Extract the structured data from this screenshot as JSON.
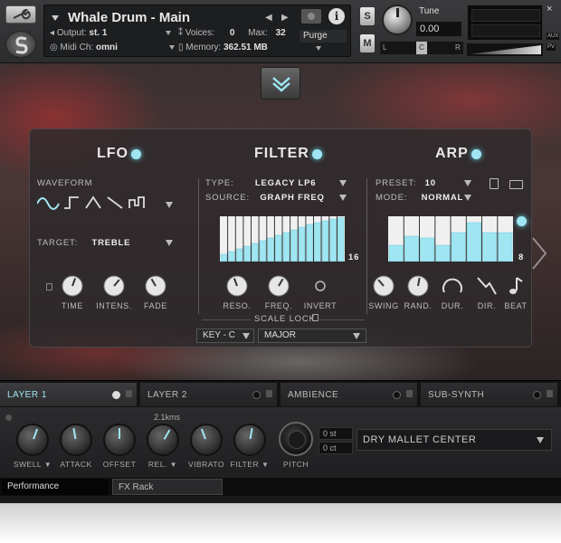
{
  "header": {
    "title": "Whale Drum - Main",
    "output_label": "Output:",
    "output_value": "st. 1",
    "midi_label": "Midi Ch:",
    "midi_value": "omni",
    "voices_label": "Voices:",
    "voices_value": "0",
    "max_label": "Max:",
    "max_value": "32",
    "memory_label": "Memory:",
    "memory_value": "362.51 MB",
    "purge_label": "Purge",
    "solo_label": "S",
    "mute_label": "M",
    "tune_label": "Tune",
    "tune_value": "0.00",
    "pan_left": "L",
    "pan_center": "C",
    "pan_right": "R",
    "aux_label": "AUX",
    "pv_label": "PV",
    "close": "×"
  },
  "lfo": {
    "title": "LFO",
    "waveform_label": "WAVEFORM",
    "target_label": "TARGET:",
    "target_value": "TREBLE",
    "knobs": [
      "TIME",
      "INTENS.",
      "FADE"
    ]
  },
  "filter": {
    "title": "FILTER",
    "type_label": "TYPE:",
    "type_value": "LEGACY LP6",
    "source_label": "SOURCE:",
    "source_value": "GRAPH FREQ",
    "steps_count": "16",
    "step_values": [
      0.16,
      0.22,
      0.28,
      0.34,
      0.4,
      0.46,
      0.52,
      0.58,
      0.64,
      0.7,
      0.76,
      0.82,
      0.86,
      0.9,
      0.94,
      0.97
    ],
    "knobs": [
      "RESO.",
      "FREQ.",
      "INVERT"
    ],
    "scale_lock_label": "SCALE LOCK",
    "key_value": "KEY - C",
    "scale_value": "MAJOR"
  },
  "arp": {
    "title": "ARP",
    "preset_label": "PRESET:",
    "preset_value": "10",
    "mode_label": "MODE:",
    "mode_value": "NORMAL",
    "steps_count": "8",
    "step_values": [
      0.36,
      0.56,
      0.52,
      0.36,
      0.64,
      0.86,
      0.64,
      0.64
    ],
    "knobs": [
      "SWING",
      "RAND.",
      "DUR.",
      "DIR.",
      "BEAT"
    ]
  },
  "layers": [
    {
      "name": "LAYER 1"
    },
    {
      "name": "LAYER 2"
    },
    {
      "name": "AMBIENCE"
    },
    {
      "name": "SUB-SYNTH"
    }
  ],
  "controls": {
    "knobs": [
      "SWELL",
      "ATTACK",
      "OFFSET",
      "REL.",
      "VIBRATO",
      "FILTER",
      "PITCH"
    ],
    "rel_value": "2.1kms",
    "st_value": "0 st",
    "ct_value": "0 ct",
    "preset": "DRY MALLET CENTER"
  },
  "bottom_tabs": {
    "performance": "Performance",
    "fx_rack": "FX Rack"
  },
  "colors": {
    "accent": "#9fe6f2"
  }
}
